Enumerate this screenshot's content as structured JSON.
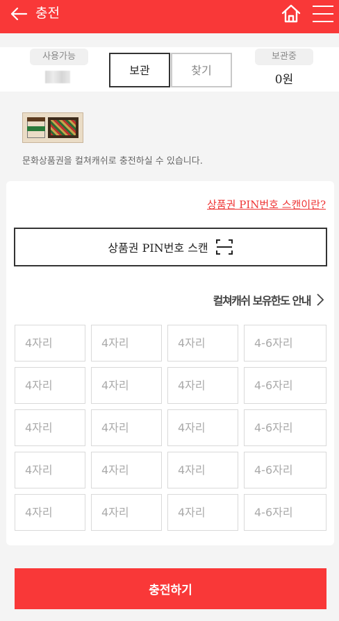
{
  "header": {
    "title": "충전",
    "back_icon": "arrow-left-icon",
    "home_icon": "home-icon",
    "menu_icon": "hamburger-menu-icon",
    "color": "#f93838"
  },
  "balance": {
    "available_label": "사용가능",
    "stored_label": "보관중",
    "stored_value": "0원",
    "segment": {
      "store_label": "보관",
      "find_label": "찾기",
      "active": "보관"
    }
  },
  "voucher": {
    "image_name": "culture-gift-voucher-image",
    "description": "문화상품권을 컬쳐캐쉬로 충전하실 수 있습니다."
  },
  "scan": {
    "help_link": "상품권 PIN번호 스캔이란?",
    "button_label": "상품권 PIN번호 스캔",
    "button_icon": "scan-frame-icon"
  },
  "limit_link": "컬쳐캐쉬 보유한도 안내",
  "pin_rows": [
    [
      "4자리",
      "4자리",
      "4자리",
      "4-6자리"
    ],
    [
      "4자리",
      "4자리",
      "4자리",
      "4-6자리"
    ],
    [
      "4자리",
      "4자리",
      "4자리",
      "4-6자리"
    ],
    [
      "4자리",
      "4자리",
      "4자리",
      "4-6자리"
    ],
    [
      "4자리",
      "4자리",
      "4자리",
      "4-6자리"
    ]
  ],
  "submit_label": "충전하기"
}
